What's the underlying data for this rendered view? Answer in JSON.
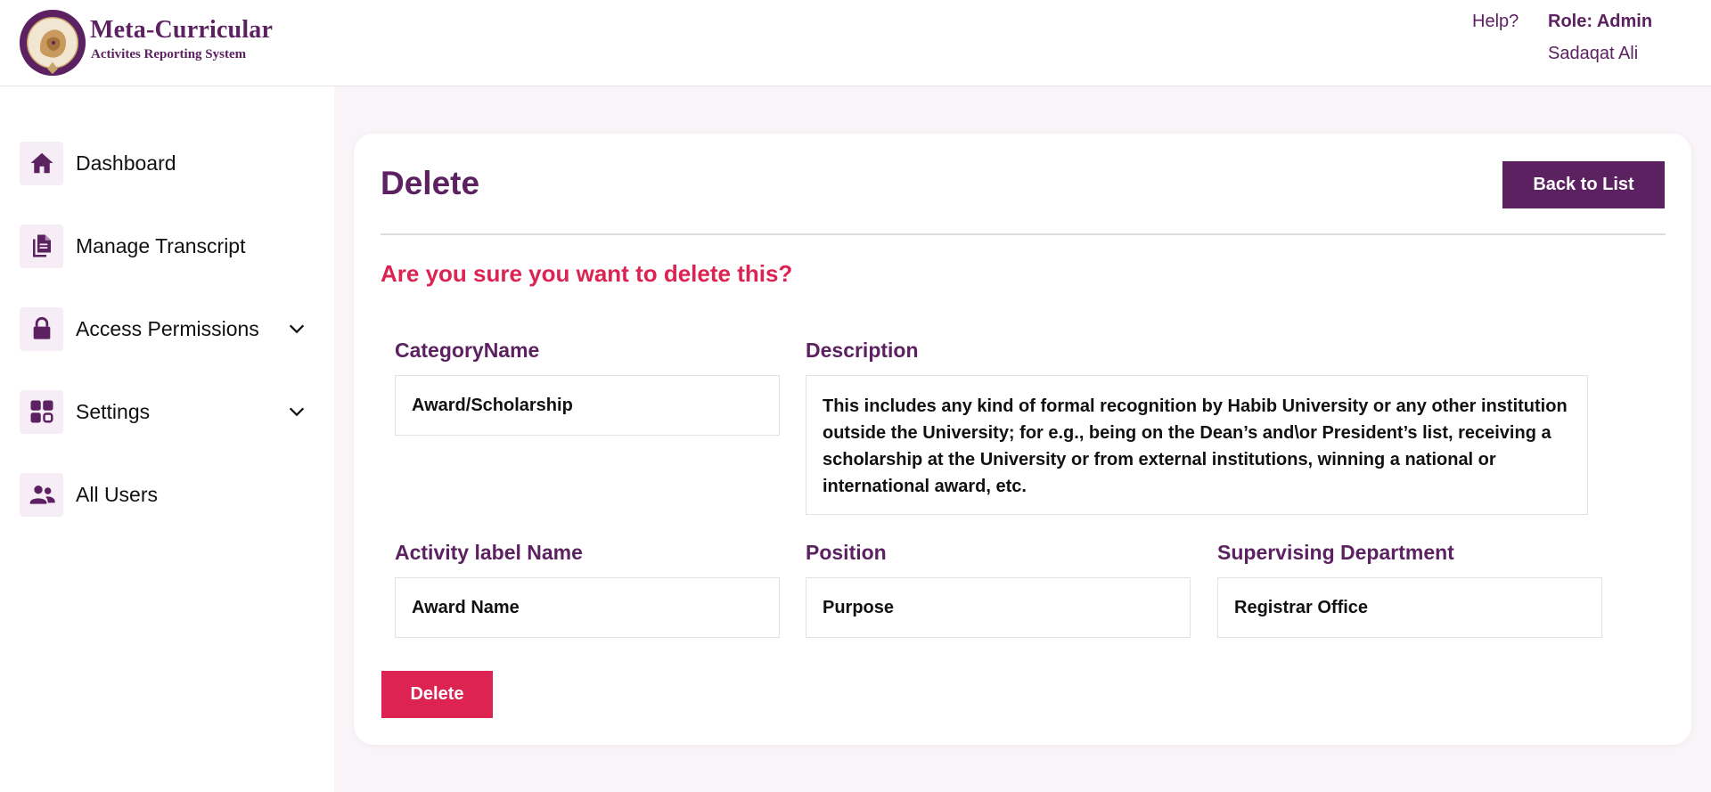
{
  "header": {
    "brand_title": "Meta-Curricular",
    "brand_subtitle": "Activites Reporting System",
    "logo_text": "HABIB UNIVERSITY",
    "help_label": "Help?",
    "role_label": "Role: Admin",
    "user_name": "Sadaqat Ali"
  },
  "sidebar": {
    "items": [
      {
        "label": "Dashboard",
        "icon": "home-icon",
        "expandable": false
      },
      {
        "label": "Manage Transcript",
        "icon": "documents-icon",
        "expandable": false
      },
      {
        "label": "Access Permissions",
        "icon": "lock-icon",
        "expandable": true
      },
      {
        "label": "Settings",
        "icon": "grid-icon",
        "expandable": true
      },
      {
        "label": "All Users",
        "icon": "users-icon",
        "expandable": false
      }
    ]
  },
  "main": {
    "title": "Delete",
    "back_button_label": "Back to List",
    "confirm_question": "Are you sure you want to delete this?",
    "fields": {
      "category_name": {
        "label": "CategoryName",
        "value": "Award/Scholarship"
      },
      "description": {
        "label": "Description",
        "value": "This includes any kind of formal recognition by Habib University or any other institution outside the University; for e.g., being on the Dean’s and\\or President’s list, receiving a scholarship at the University or from external institutions, winning a national or international award, etc."
      },
      "activity_label_name": {
        "label": "Activity label Name",
        "value": "Award Name"
      },
      "position": {
        "label": "Position",
        "value": "Purpose"
      },
      "supervising_department": {
        "label": "Supervising Department",
        "value": "Registrar Office"
      }
    },
    "delete_button_label": "Delete"
  },
  "colors": {
    "brand_purple": "#5c2161",
    "danger_red": "#dc2352",
    "icon_bg": "#f6edf6",
    "page_bg": "#f8f4f8"
  }
}
